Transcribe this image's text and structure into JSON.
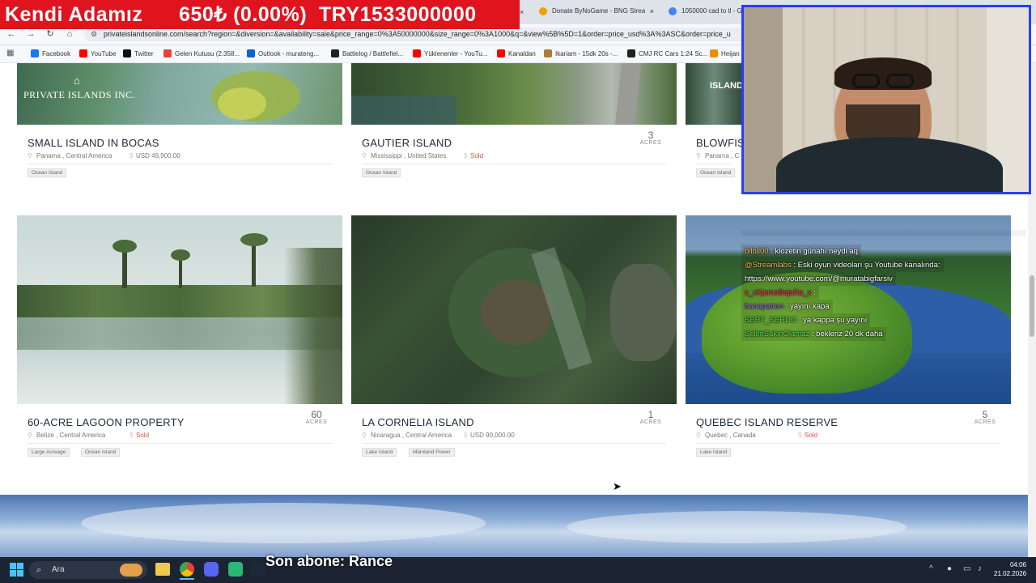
{
  "stream_overlay": {
    "banner_text": "Kendi Adamız      650₺ (0.00%)  TRY1533000000",
    "sub_alert": "Son abone: Rance"
  },
  "browser": {
    "tabs": [
      {
        "title": "Donate ByNoGame - BNG Strea",
        "close": "×"
      },
      {
        "title": "1050000 cad to tl - G",
        "close": ""
      }
    ],
    "url": "privateislandsonline.com/search?region=&diversion=&availability=sale&price_range=0%3A50000000&size_range=0%3A1000&q=&view%5B%5D=1&order=price_usd%3A%3ASC&order=price_u",
    "bookmarks": [
      {
        "label": "Facebook",
        "color": "#1877f2"
      },
      {
        "label": "YouTube",
        "color": "#ff0000"
      },
      {
        "label": "Twitter",
        "color": "#111111"
      },
      {
        "label": "Gelen Kutusu (2.358...",
        "color": "#ea4335"
      },
      {
        "label": "Outlook - murateng...",
        "color": "#0a64d6"
      },
      {
        "label": "Battlelog / Battlefiel...",
        "color": "#222222"
      },
      {
        "label": "Yüklenenler - YouTu...",
        "color": "#ff0000"
      },
      {
        "label": "Kanaldan",
        "color": "#ff0000"
      },
      {
        "label": "Ikariam - 15dk 20s -...",
        "color": "#b07a3a"
      },
      {
        "label": "CMJ RC Cars 1:24 Sc...",
        "color": "#222222"
      },
      {
        "label": "Heijan",
        "color": "#f08c00"
      }
    ]
  },
  "listings_top": [
    {
      "title": "SMALL ISLAND IN BOCAS",
      "location": "Panama , Central America",
      "price": "USD 49,900.00",
      "sold": "",
      "acres": "",
      "acres_label": "",
      "tags": [
        "Ocean Island"
      ],
      "logo": "PRIVATE ISLANDS INC."
    },
    {
      "title": "GAUTIER ISLAND",
      "location": "Mississippi , United States",
      "price": "",
      "sold": "Sold",
      "acres": "3",
      "acres_label": "ACRES",
      "tags": [
        "Ocean Island"
      ]
    },
    {
      "title": "BLOWFIS",
      "location": "Panama , C",
      "price": "",
      "sold": "",
      "acres": "",
      "acres_label": "",
      "tags": [
        "Ocean Island"
      ],
      "img_text": "ISLAND"
    }
  ],
  "listings_bottom": [
    {
      "title": "60-ACRE LAGOON PROPERTY",
      "location": "Belize , Central America",
      "price": "",
      "sold": "Sold",
      "acres": "60",
      "acres_label": "ACRES",
      "tags": [
        "Large Acreage",
        "Ocean Island"
      ]
    },
    {
      "title": "LA CORNELIA ISLAND",
      "location": "Nicaragua , Central America",
      "price": "USD 90,000.00",
      "sold": "",
      "acres": "1",
      "acres_label": "ACRES",
      "tags": [
        "Lake Island",
        "Mainland Power"
      ]
    },
    {
      "title": "QUEBEC ISLAND RESERVE",
      "location": "Quebec , Canada",
      "price": "",
      "sold": "Sold",
      "acres": "5",
      "acres_label": "ACRES",
      "tags": [
        "Lake Island"
      ]
    }
  ],
  "chat": [
    {
      "user": "bilbil00",
      "msg": " : klozetin günahı neydi aq",
      "color": "#ffb84d"
    },
    {
      "user": "@Streamlabs",
      "msg": " : Eski oyun videoları şu Youtube kanalında:",
      "color": "#ffb84d"
    },
    {
      "user": "",
      "msg": "https://www.youtube.com/@muratabigfarsiv",
      "color": "#ffffff"
    },
    {
      "user": "x_xKjemoBejaKa_x",
      "msg": " :",
      "color": "#ff3366"
    },
    {
      "user": "banapatron",
      "msg": " : yayını kapa",
      "color": "#9b6bff"
    },
    {
      "user": "SERT_SERDO",
      "msg": " : ya kappa şu yayını",
      "color": "#5de05d"
    },
    {
      "user": "SelimSakinOlamaz",
      "msg": " : bekleriz 20 dk daha",
      "color": "#5de05d"
    }
  ],
  "taskbar": {
    "search_placeholder": "Ara",
    "time": "04:06",
    "date": "21.02.2026"
  }
}
